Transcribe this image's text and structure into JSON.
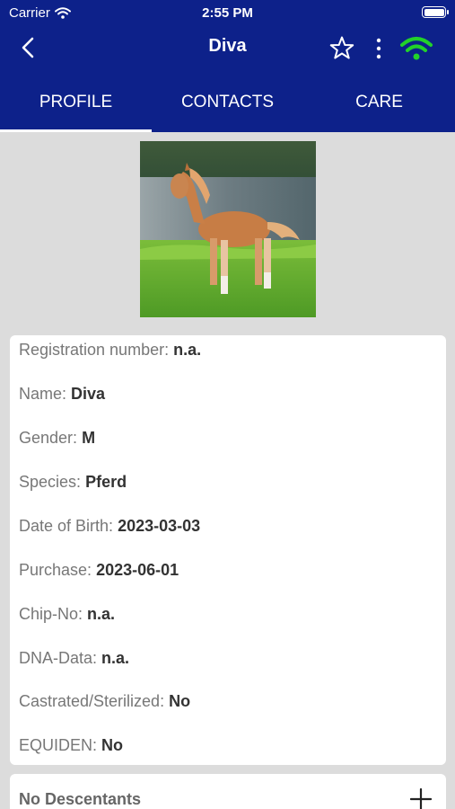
{
  "status_bar": {
    "carrier": "Carrier",
    "time": "2:55 PM"
  },
  "nav": {
    "title": "Diva",
    "icons": {
      "back": "chevron-left-icon",
      "favorite": "star-outline-icon",
      "more": "more-vertical-icon",
      "connection": "wifi-icon"
    },
    "connection_color": "#22d12a",
    "bar_color": "#0d218a"
  },
  "tabs": [
    {
      "label": "PROFILE",
      "active": true
    },
    {
      "label": "CONTACTS",
      "active": false
    },
    {
      "label": "CARE",
      "active": false
    }
  ],
  "profile": {
    "fields": [
      {
        "label": "Registration number:",
        "value": "n.a."
      },
      {
        "label": "Name:",
        "value": "Diva"
      },
      {
        "label": "Gender:",
        "value": "M"
      },
      {
        "label": "Species:",
        "value": "Pferd"
      },
      {
        "label": "Date of Birth:",
        "value": "2023-03-03"
      },
      {
        "label": "Purchase:",
        "value": "2023-06-01"
      },
      {
        "label": "Chip-No:",
        "value": "n.a."
      },
      {
        "label": "DNA-Data:",
        "value": "n.a."
      },
      {
        "label": "Castrated/Sterilized:",
        "value": "No"
      },
      {
        "label": "EQUIDEN:",
        "value": "No"
      }
    ]
  },
  "descendants": {
    "label": "No Descentants",
    "icon": "plus-icon"
  }
}
